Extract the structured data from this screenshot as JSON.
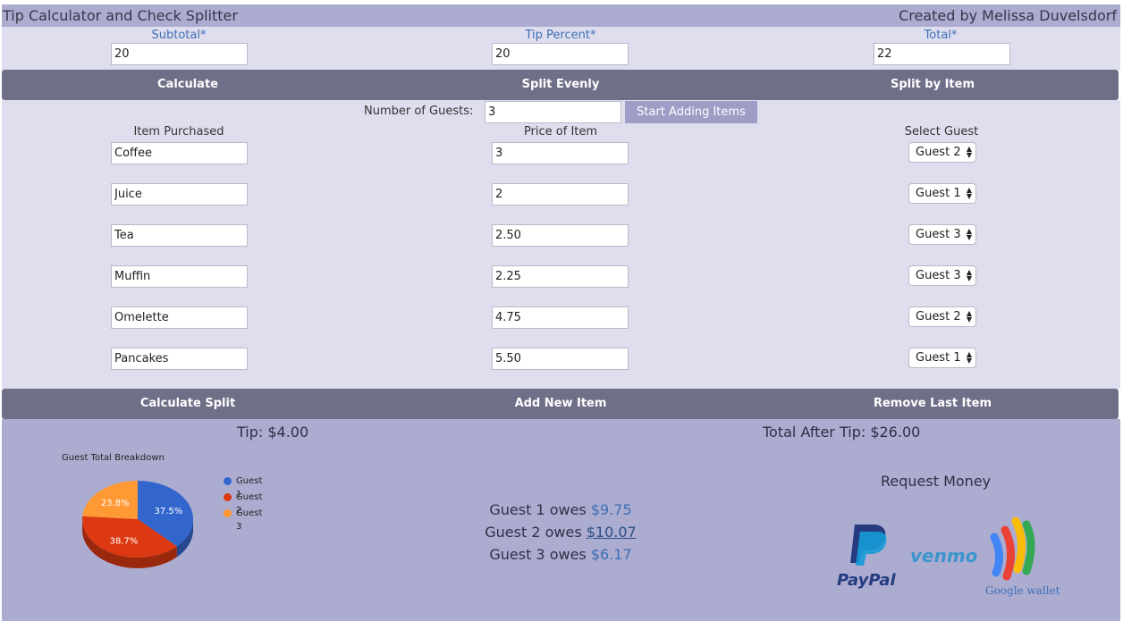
{
  "header": {
    "title": "Tip Calculator and Check Splitter",
    "credit": "Created by Melissa Duvelsdorf"
  },
  "inputs": {
    "subtotal_label": "Subtotal*",
    "subtotal_value": "20",
    "tip_label": "Tip Percent*",
    "tip_value": "20",
    "total_label": "Total*",
    "total_value": "22"
  },
  "actions_top": {
    "calculate": "Calculate",
    "split_evenly": "Split Evenly",
    "split_by_item": "Split by Item"
  },
  "guests": {
    "label": "Number of Guests:",
    "value": "3",
    "start_button": "Start Adding Items"
  },
  "columns": {
    "item": "Item Purchased",
    "price": "Price of Item",
    "guest": "Select Guest"
  },
  "items": [
    {
      "name": "Coffee",
      "price": "3",
      "guest": "Guest 2"
    },
    {
      "name": "Juice",
      "price": "2",
      "guest": "Guest 1"
    },
    {
      "name": "Tea",
      "price": "2.50",
      "guest": "Guest 3"
    },
    {
      "name": "Muffin",
      "price": "2.25",
      "guest": "Guest 3"
    },
    {
      "name": "Omelette",
      "price": "4.75",
      "guest": "Guest 2"
    },
    {
      "name": "Pancakes",
      "price": "5.50",
      "guest": "Guest 1"
    }
  ],
  "actions_bottom": {
    "calculate_split": "Calculate Split",
    "add_item": "Add New Item",
    "remove_item": "Remove Last Item"
  },
  "results": {
    "tip": "Tip: $4.00",
    "total_after_tip": "Total After Tip: $26.00",
    "owes": [
      {
        "label": "Guest 1 owes",
        "amount": "$9.75"
      },
      {
        "label": "Guest 2 owes",
        "amount": "$10.07"
      },
      {
        "label": "Guest 3 owes",
        "amount": "$6.17"
      }
    ]
  },
  "request": {
    "title": "Request Money",
    "paypal": "PayPal",
    "venmo": "venmo",
    "google_wallet": "Google wallet"
  },
  "chart_data": {
    "type": "pie",
    "title": "Guest Total Breakdown",
    "series": [
      {
        "name": "Guest 1",
        "value": 37.5,
        "label": "37.5%",
        "color": "#3366cc"
      },
      {
        "name": "Guest 2",
        "value": 38.7,
        "label": "38.7%",
        "color": "#dc3912"
      },
      {
        "name": "Guest 3",
        "value": 23.8,
        "label": "23.8%",
        "color": "#ff9933"
      }
    ],
    "legend_position": "right"
  },
  "colors": {
    "header_bg": "#acacd1",
    "strip_bg": "#dedeef",
    "action_bar": "#6f6f88",
    "accent_text": "#3f6eb5"
  }
}
